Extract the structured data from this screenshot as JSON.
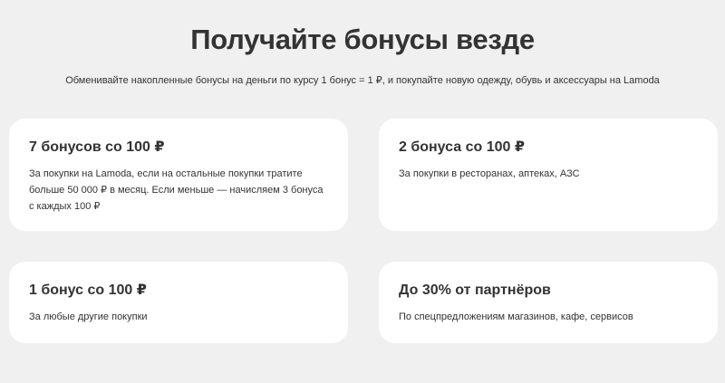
{
  "section": {
    "title": "Получайте бонусы везде",
    "subtitle": "Обменивайте накопленные бонусы на деньги по курсу 1 бонус = 1 ₽, и покупайте новую одежду, обувь и аксессуары на Lamoda"
  },
  "cards": [
    {
      "heading": "7 бонусов со 100 ₽",
      "text": "За покупки на Lamoda, если на остальные покупки тратите больше 50 000 ₽ в месяц. Если меньше — начисляем 3 бонуса с каждых 100 ₽"
    },
    {
      "heading": "2 бонуса со 100 ₽",
      "text": "За покупки в ресторанах, аптеках, АЗС"
    },
    {
      "heading": "1 бонус со 100 ₽",
      "text": "За любые другие покупки"
    },
    {
      "heading": "До 30% от партнёров",
      "text": "По спецпредложениям магазинов, кафе, сервисов"
    }
  ],
  "colors": {
    "background": "#f0f0f0",
    "card": "#ffffff",
    "text": "#333333"
  }
}
